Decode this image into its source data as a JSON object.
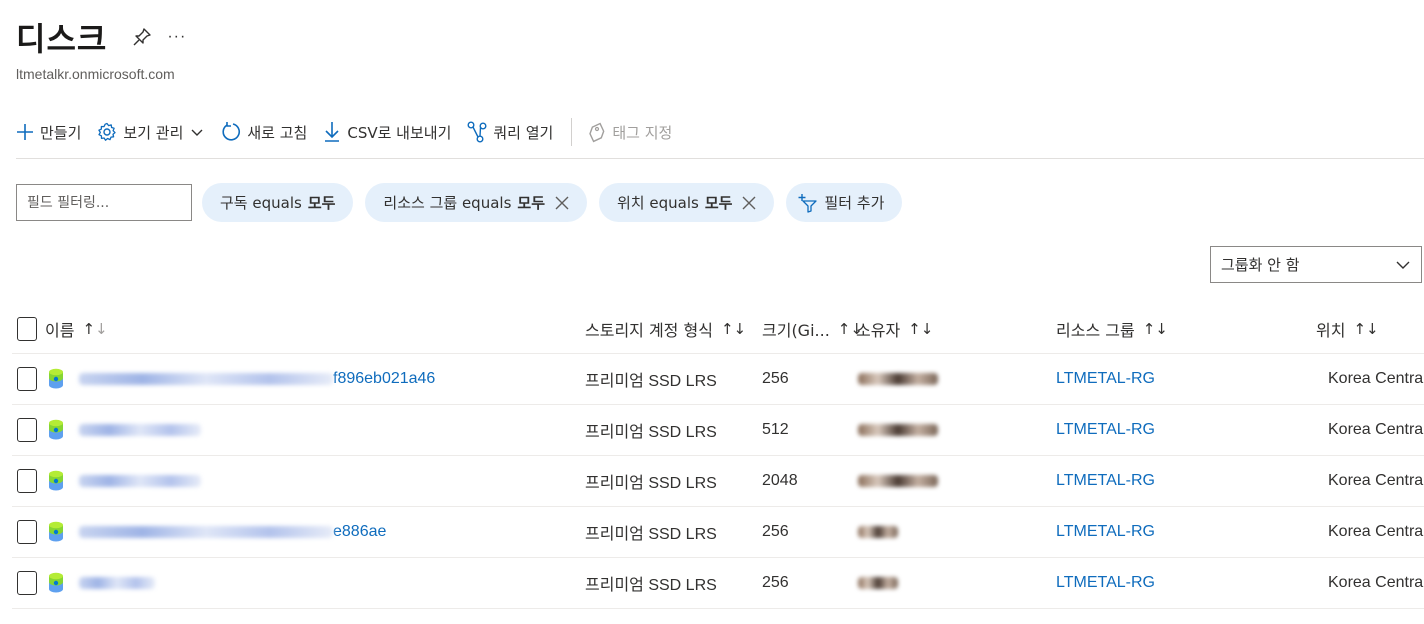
{
  "header": {
    "title": "디스크",
    "more": "···",
    "subtitle": "ltmetalkr.onmicrosoft.com"
  },
  "toolbar": {
    "create": "만들기",
    "manage_view": "보기 관리",
    "refresh": "새로 고침",
    "export_csv": "CSV로 내보내기",
    "open_query": "쿼리 열기",
    "assign_tags": "태그 지정"
  },
  "filters": {
    "field_placeholder": "필드 필터링...",
    "pills": [
      {
        "field": "구독 equals",
        "value": "모두"
      },
      {
        "field": "리소스 그룹 equals",
        "value": "모두"
      },
      {
        "field": "위치 equals",
        "value": "모두"
      }
    ],
    "add_filter": "필터 추가"
  },
  "groupby": {
    "selected": "그룹화 안 함"
  },
  "table": {
    "columns": {
      "name": "이름",
      "storage_type": "스토리지 계정 형식",
      "size": "크기(Gi...",
      "owner": "소유자",
      "resource_group": "리소스 그룹",
      "location": "위치"
    },
    "rows": [
      {
        "name_visible": "f896eb021a46",
        "storage_type": "프리미엄 SSD LRS",
        "size": "256",
        "resource_group": "LTMETAL-RG",
        "location": "Korea Central"
      },
      {
        "name_visible": "",
        "storage_type": "프리미엄 SSD LRS",
        "size": "512",
        "resource_group": "LTMETAL-RG",
        "location": "Korea Central"
      },
      {
        "name_visible": "",
        "storage_type": "프리미엄 SSD LRS",
        "size": "2048",
        "resource_group": "LTMETAL-RG",
        "location": "Korea Central"
      },
      {
        "name_visible": "e886ae",
        "storage_type": "프리미엄 SSD LRS",
        "size": "256",
        "resource_group": "LTMETAL-RG",
        "location": "Korea Central"
      },
      {
        "name_visible": "",
        "storage_type": "프리미엄 SSD LRS",
        "size": "256",
        "resource_group": "LTMETAL-RG",
        "location": "Korea Central"
      }
    ]
  },
  "colors": {
    "accent": "#0f6cbd",
    "pill_bg": "#e5f0fb"
  },
  "icons": [
    "pin-icon",
    "plus-icon",
    "gear-icon",
    "refresh-icon",
    "download-icon",
    "query-icon",
    "tag-icon",
    "filter-add-icon",
    "chevron-down-icon",
    "disk-icon",
    "sort-icon",
    "close-icon"
  ]
}
